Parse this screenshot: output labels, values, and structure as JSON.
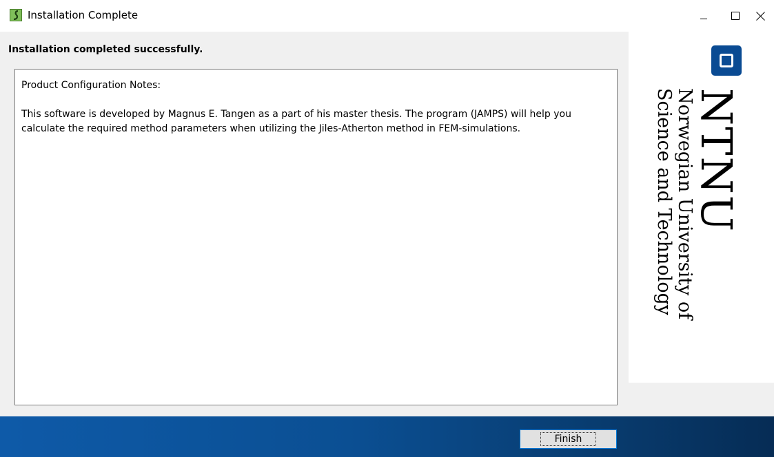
{
  "window": {
    "title": "Installation Complete",
    "icon": "app-installer-icon"
  },
  "title_controls": {
    "minimize": "minimize-icon",
    "maximize": "maximize-icon",
    "close": "close-icon"
  },
  "content": {
    "heading": "Installation completed successfully.",
    "notes_title": "Product Configuration Notes:",
    "notes_body": "This software is developed by Magnus E. Tangen as a part of his master thesis. The program (JAMPS) will help you calculate the required method parameters when utilizing the Jiles-Atherton method in FEM-simulations."
  },
  "logo": {
    "wordmark": "NTNU",
    "line1": "Norwegian University of",
    "line2": "Science and Technology",
    "brand_color": "#0a4b93"
  },
  "footer": {
    "finish_label": "Finish",
    "accent_color": "#0b4f93"
  }
}
